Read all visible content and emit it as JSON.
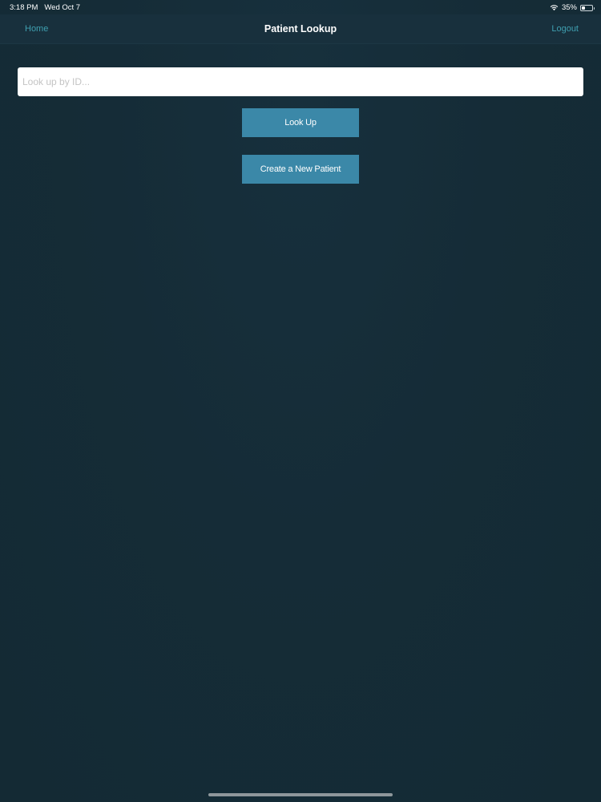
{
  "status_bar": {
    "time": "3:18 PM",
    "date": "Wed Oct 7",
    "battery_percent_label": "35%",
    "battery_level": 0.35,
    "icons": [
      "wifi-icon",
      "battery-icon"
    ]
  },
  "nav": {
    "left_label": "Home",
    "title": "Patient Lookup",
    "right_label": "Logout"
  },
  "search": {
    "placeholder": "Look up by ID...",
    "value": ""
  },
  "actions": {
    "lookup_label": "Look Up",
    "create_label": "Create a New Patient"
  },
  "colors": {
    "background": "#152c37",
    "nav_bar": "#18303d",
    "accent_link": "#3f9fb0",
    "button": "#3b88a8",
    "input_bg": "#ffffff"
  }
}
